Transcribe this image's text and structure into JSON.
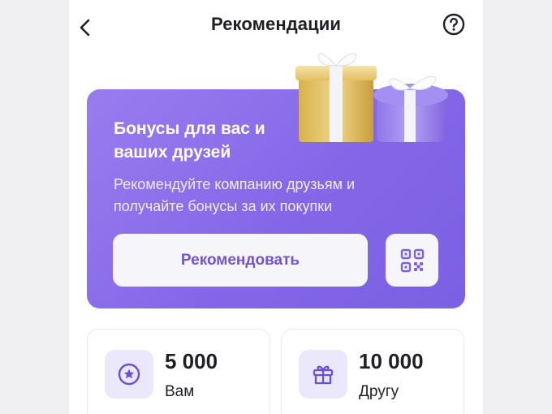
{
  "header": {
    "title": "Рекомендации",
    "back_icon": "chevron-left-icon",
    "help_icon": "question-circle-icon"
  },
  "promo": {
    "title": "Бонусы для вас и ваших друзей",
    "description": "Рекомендуйте компанию друзьям и получайте бонусы за их покупки",
    "recommend_label": "Рекомендовать",
    "qr_icon": "qr-code-icon",
    "image": "gift-boxes-illustration",
    "colors": {
      "accent": "#8467e7",
      "button_text": "#6f55d6"
    }
  },
  "stats": [
    {
      "value": "5 000",
      "label": "Вам",
      "icon": "star-circle-icon"
    },
    {
      "value": "10 000",
      "label": "Другу",
      "icon": "gift-icon"
    }
  ]
}
